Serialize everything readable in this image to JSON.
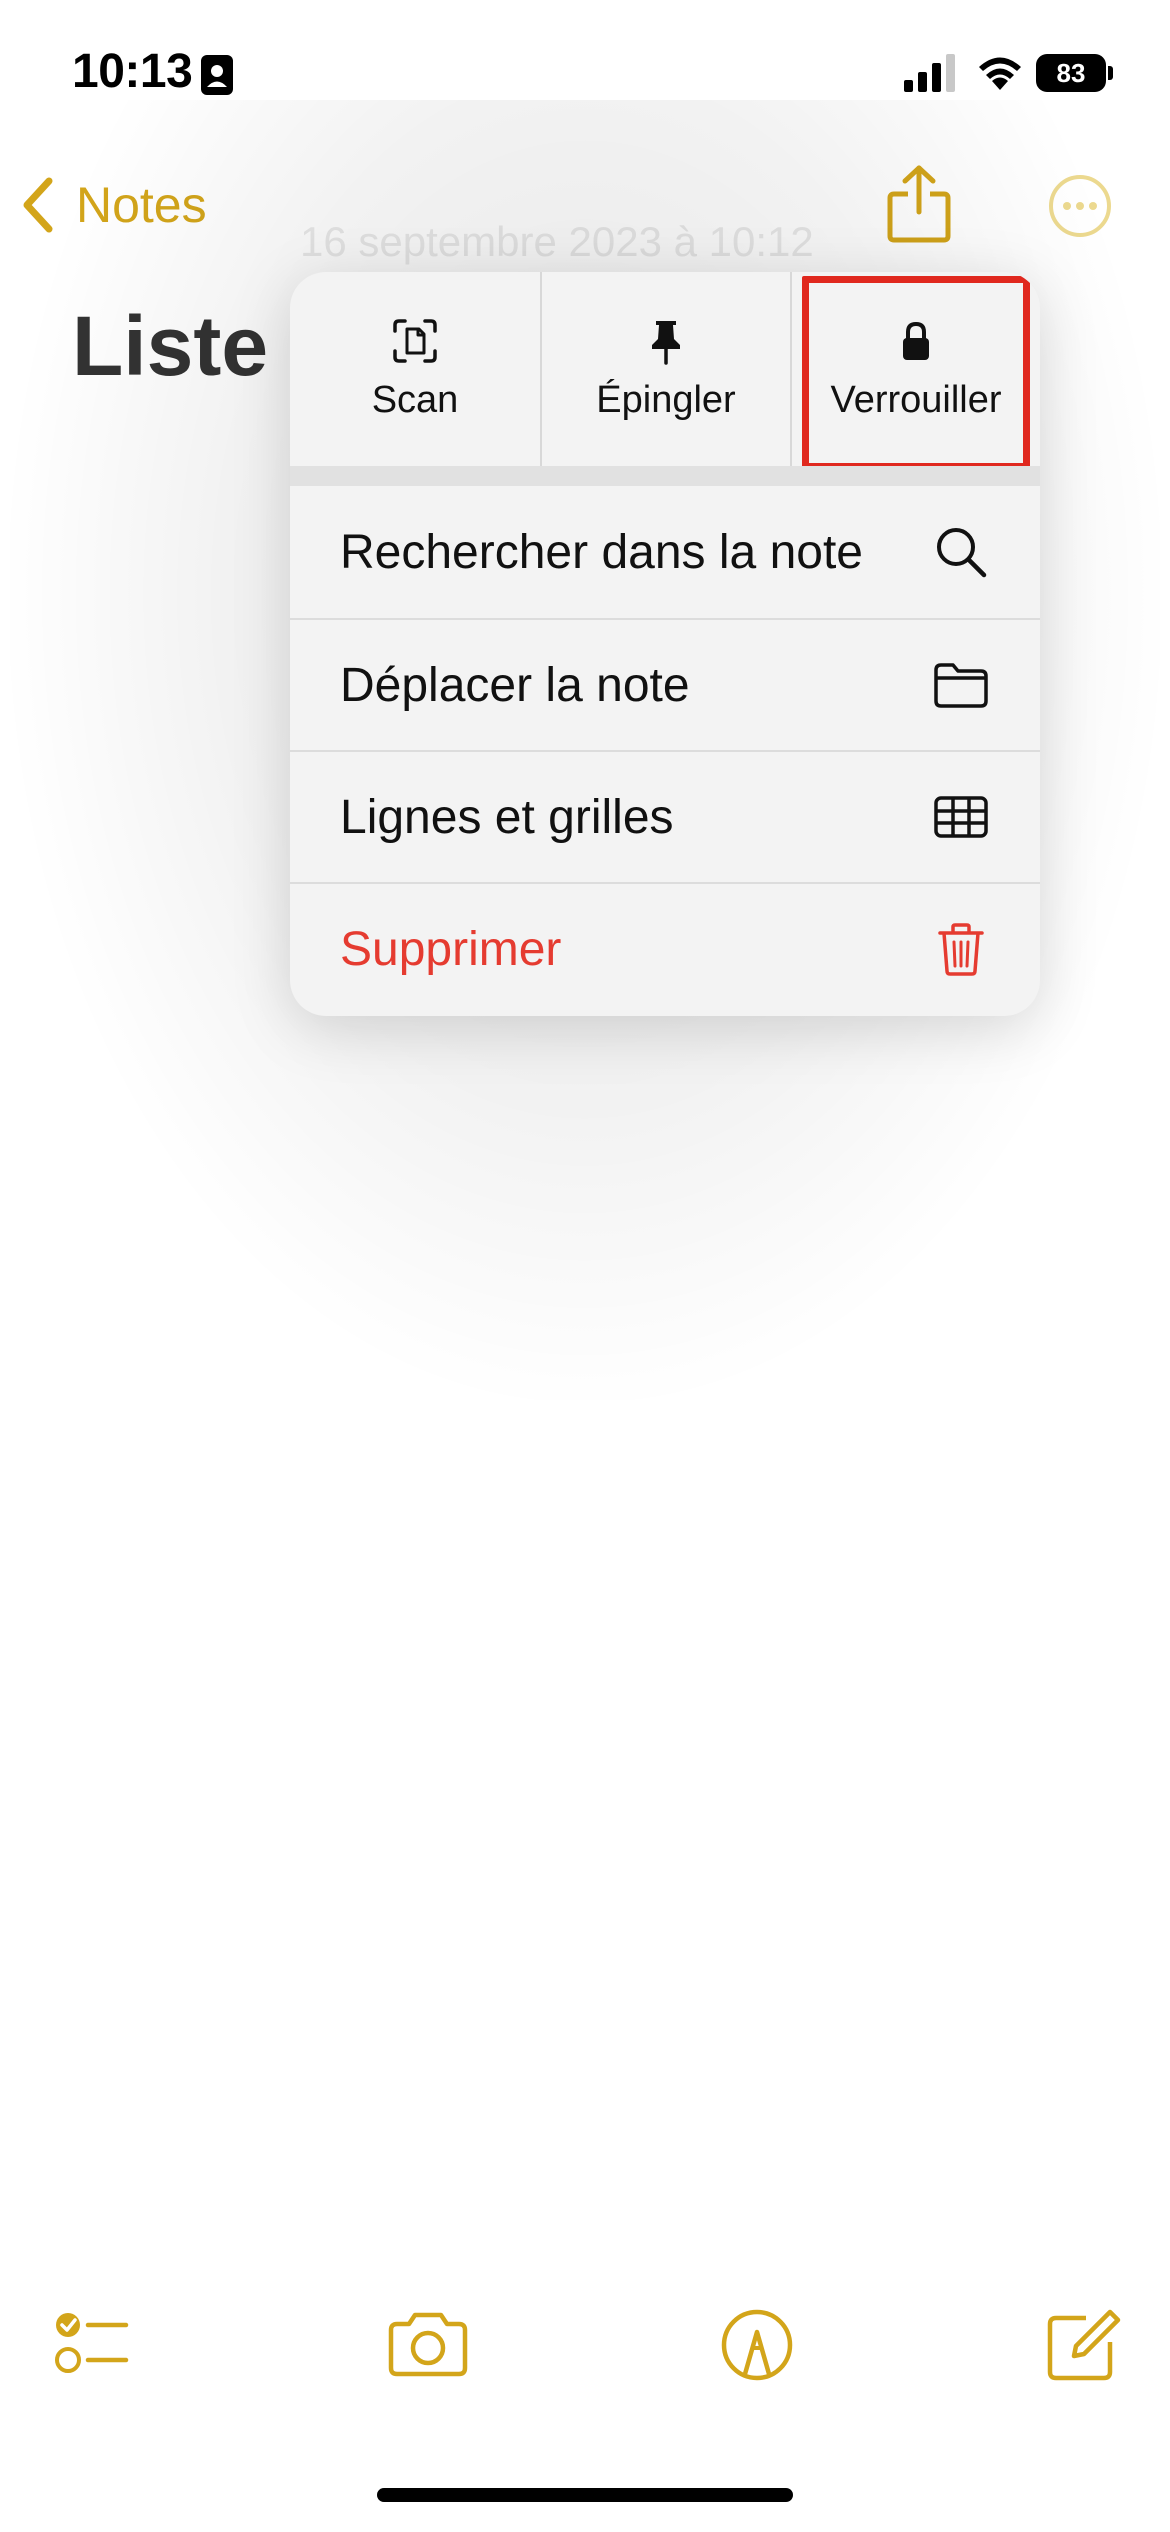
{
  "status_bar": {
    "time": "10:13",
    "battery_level": "83"
  },
  "nav": {
    "back_label": "Notes"
  },
  "note": {
    "date": "16 septembre 2023 à 10:12",
    "title": "Liste u"
  },
  "menu": {
    "quick_actions": [
      {
        "label": "Scan",
        "icon": "scan-document-icon"
      },
      {
        "label": "Épingler",
        "icon": "pin-icon"
      },
      {
        "label": "Verrouiller",
        "icon": "lock-icon",
        "highlighted": true
      }
    ],
    "items": [
      {
        "label": "Rechercher dans la note",
        "icon": "search-icon"
      },
      {
        "label": "Déplacer la note",
        "icon": "folder-icon"
      },
      {
        "label": "Lignes et grilles",
        "icon": "grid-icon"
      },
      {
        "label": "Supprimer",
        "icon": "trash-icon",
        "destructive": true
      }
    ]
  },
  "toolbar": {
    "items": [
      "checklist-icon",
      "camera-icon",
      "markup-icon",
      "compose-icon"
    ]
  },
  "colors": {
    "accent": "#d3a51a",
    "destructive": "#e53b30",
    "highlight": "#e0281e",
    "menu_background": "#f3f3f3"
  }
}
